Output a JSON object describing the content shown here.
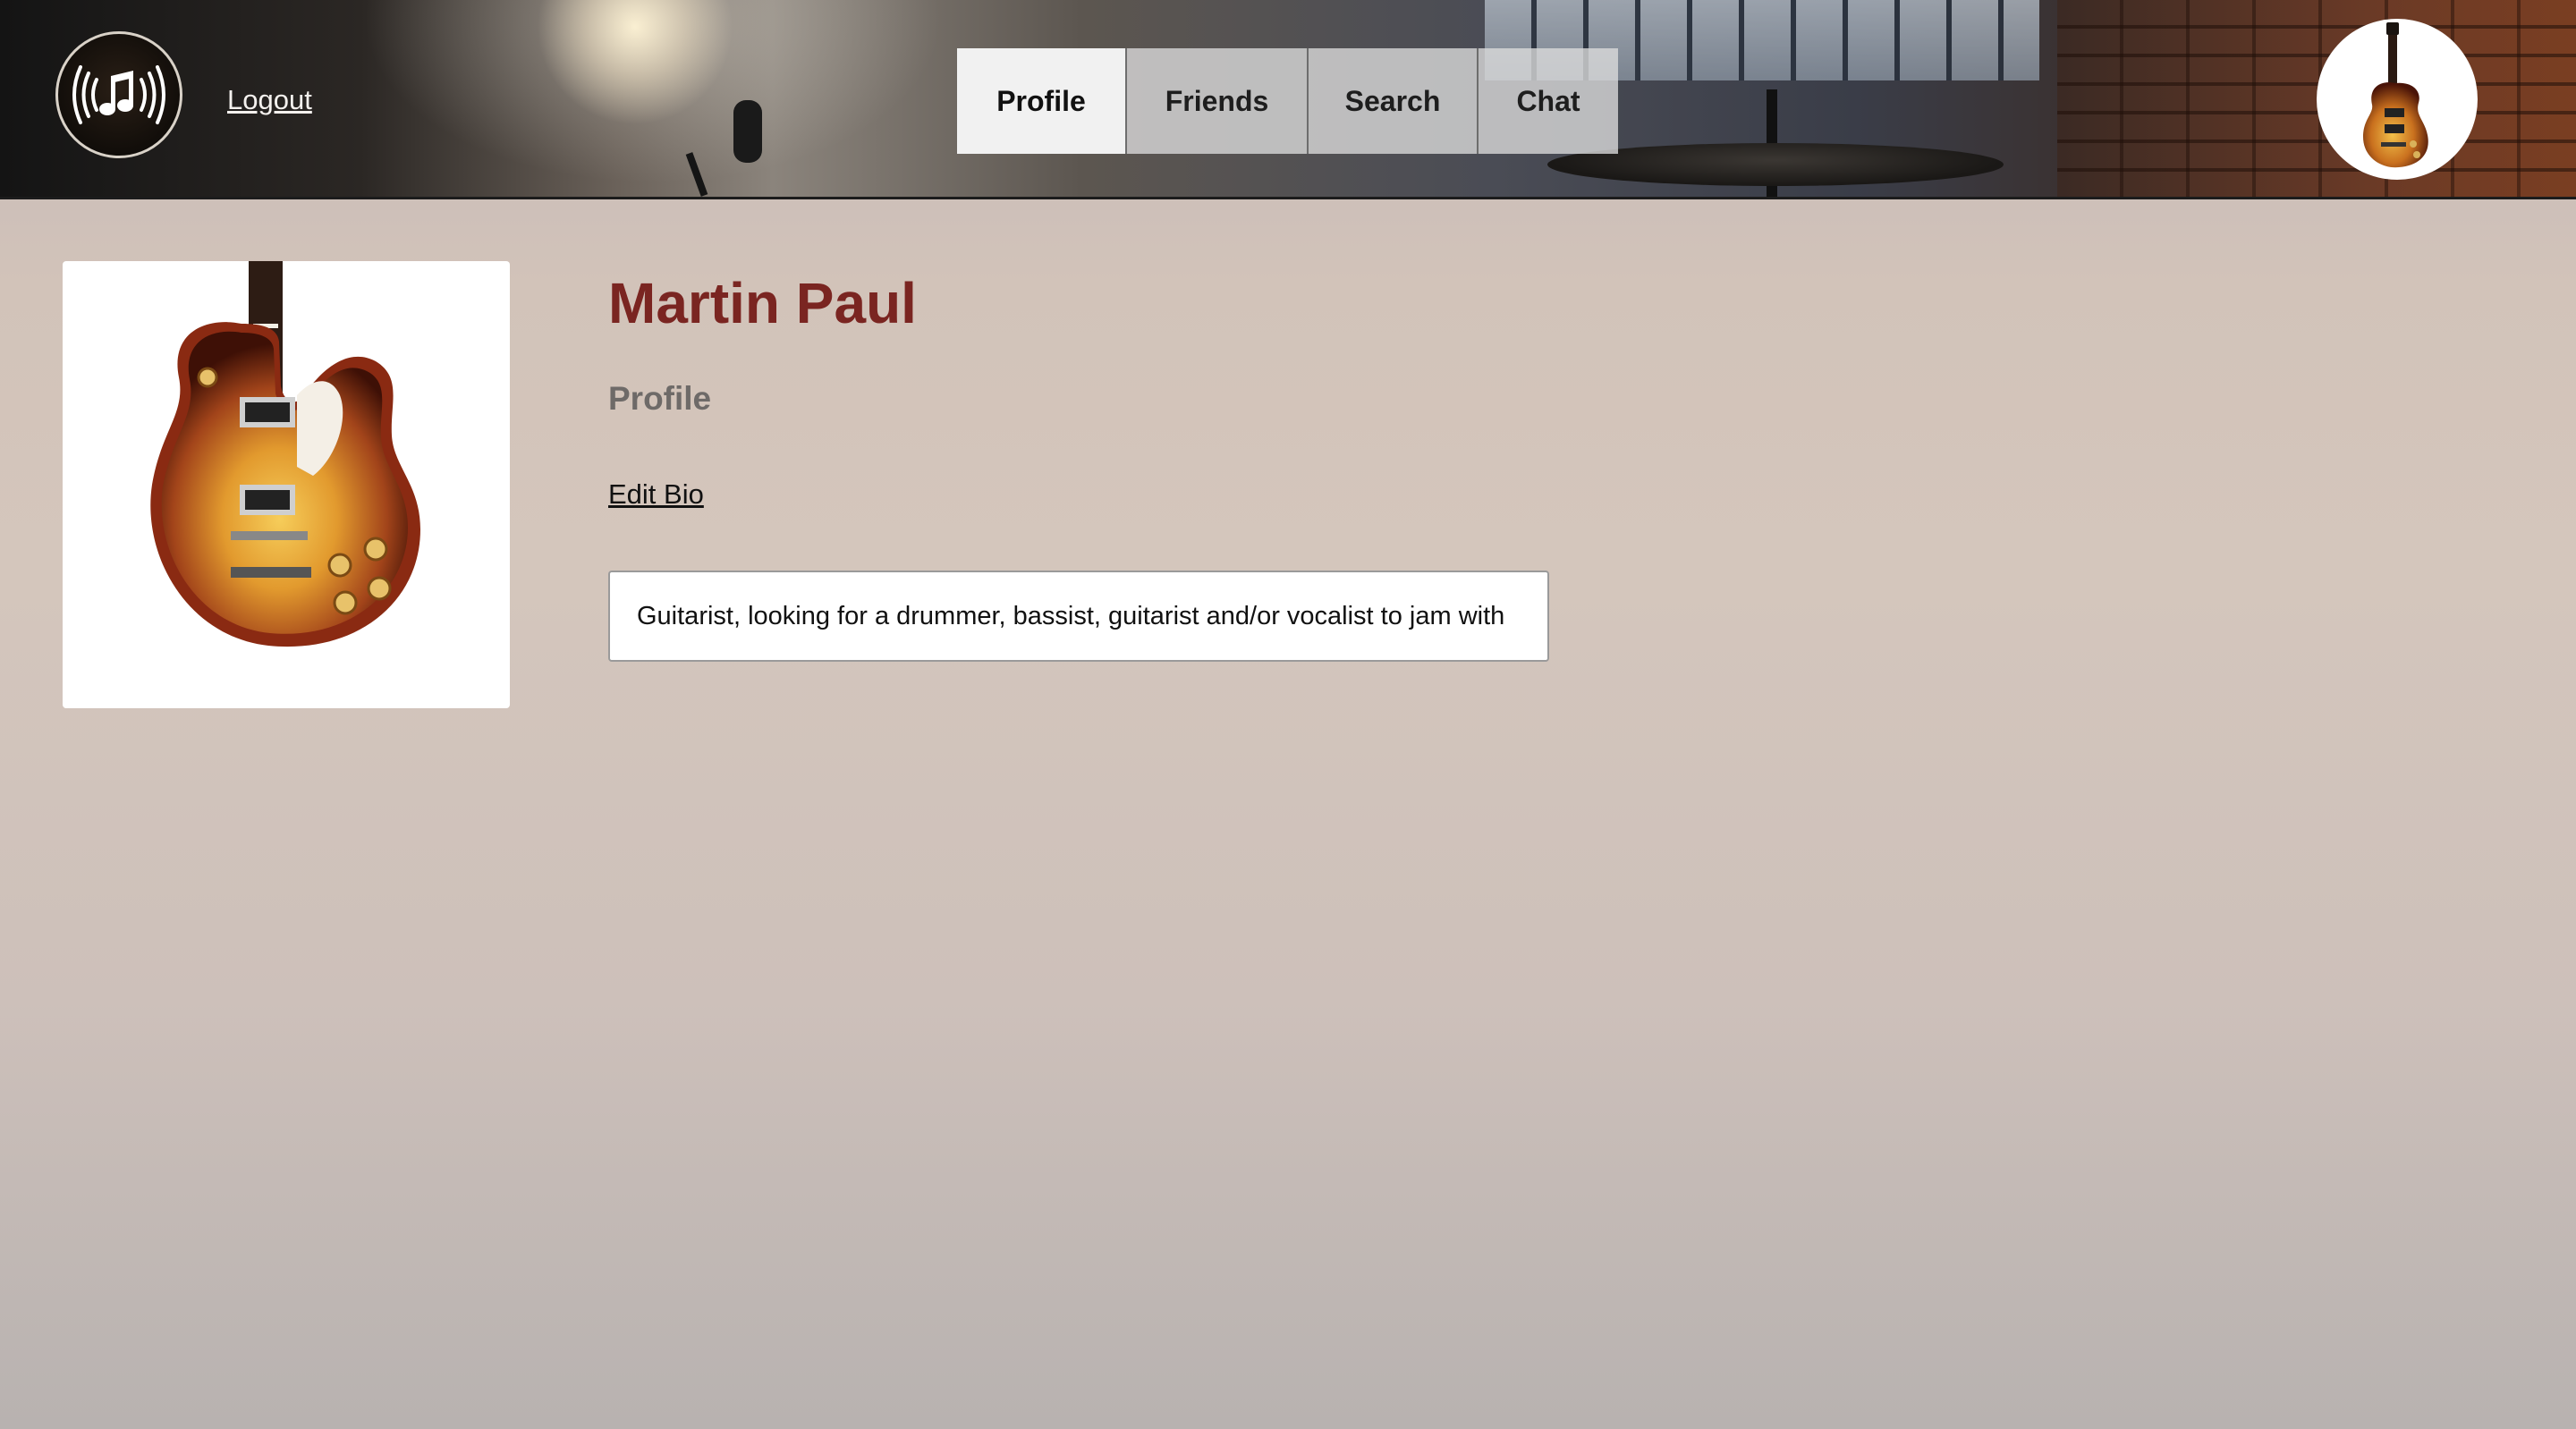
{
  "header": {
    "logo_icon": "music-note-broadcast-icon",
    "logout_label": "Logout",
    "tabs": [
      {
        "label": "Profile",
        "active": true
      },
      {
        "label": "Friends",
        "active": false
      },
      {
        "label": "Search",
        "active": false
      },
      {
        "label": "Chat",
        "active": false
      }
    ],
    "avatar_icon": "guitar-avatar-icon"
  },
  "profile": {
    "name": "Martin Paul",
    "section_title": "Profile",
    "edit_bio_label": "Edit Bio",
    "bio": "Guitarist, looking for a drummer, bassist, guitarist and/or vocalist to jam with",
    "photo_icon": "electric-guitar-photo"
  },
  "colors": {
    "name_color": "#7a2521",
    "subheading_color": "#6e6a68",
    "active_tab_bg": "#f1f1f1",
    "inactive_tab_bg": "#dcdcdc"
  }
}
